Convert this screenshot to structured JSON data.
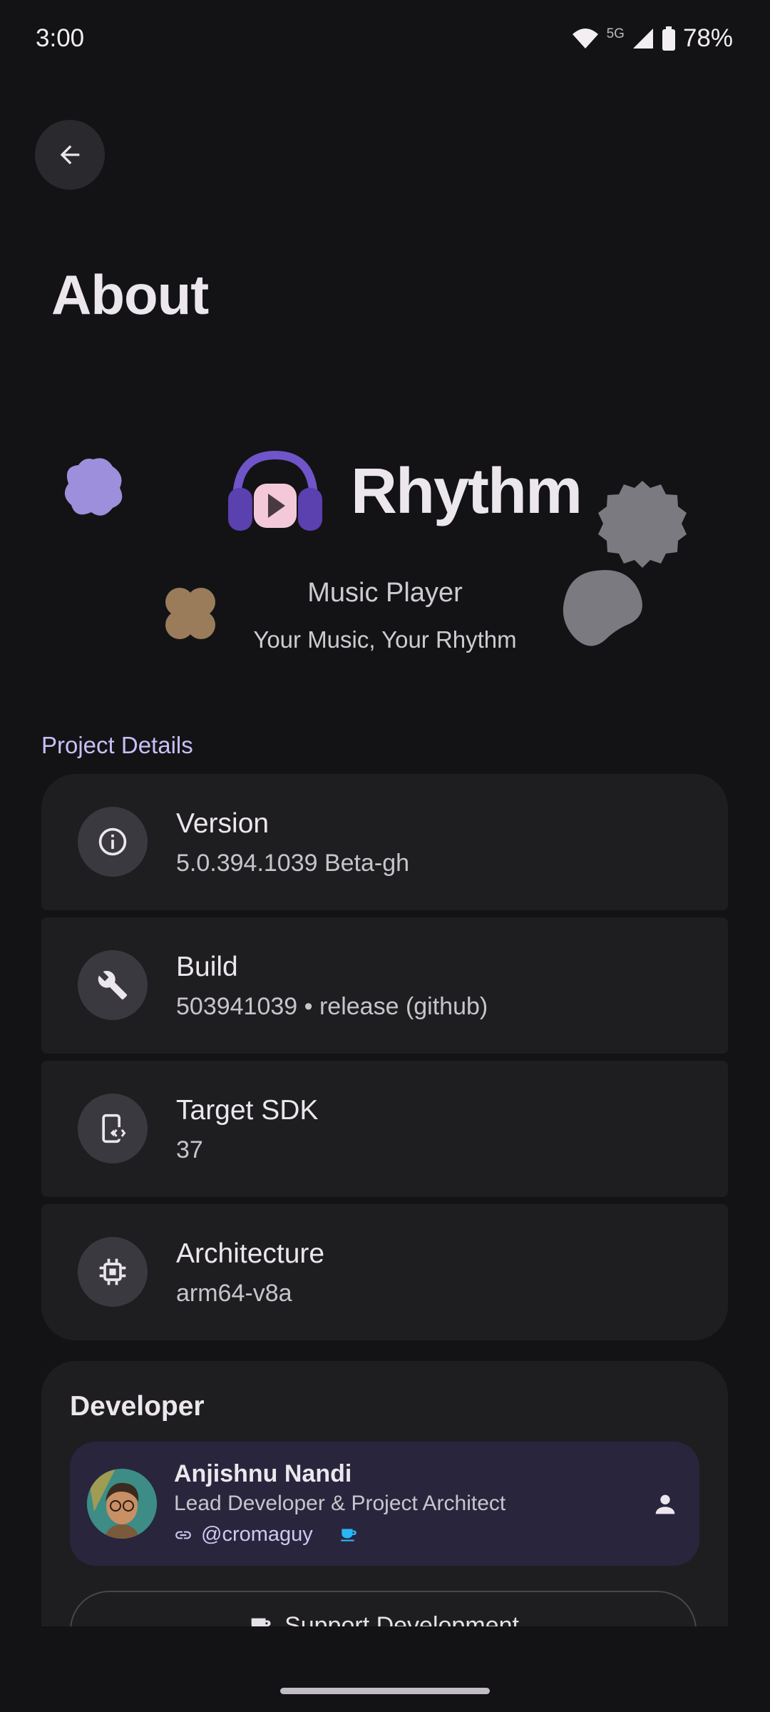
{
  "status_bar": {
    "time": "3:00",
    "network": "5G",
    "battery": "78%",
    "icons": [
      "wifi-icon",
      "signal-icon",
      "battery-icon"
    ]
  },
  "header": {
    "back_icon": "arrow-back-icon",
    "title": "About"
  },
  "hero": {
    "app_name": "Rhythm",
    "subtitle": "Music Player",
    "tagline": "Your Music, Your Rhythm",
    "app_icon": "headphones-play-icon"
  },
  "project_details": {
    "label": "Project Details",
    "items": [
      {
        "title": "Version",
        "value": "5.0.394.1039 Beta-gh",
        "icon": "info-icon"
      },
      {
        "title": "Build",
        "value": "503941039 • release (github)",
        "icon": "wrench-icon"
      },
      {
        "title": "Target SDK",
        "value": "37",
        "icon": "phone-code-icon"
      },
      {
        "title": "Architecture",
        "value": "arm64-v8a",
        "icon": "chip-icon"
      }
    ]
  },
  "developer": {
    "heading": "Developer",
    "name": "Anjishnu Nandi",
    "role": "Lead Developer & Project Architect",
    "handle": "@cromaguy",
    "support_label": "Support Development"
  },
  "colors": {
    "background": "#131315",
    "card": "#1e1e21",
    "accent": "#c9bff7",
    "developer_card": "#29253d"
  }
}
